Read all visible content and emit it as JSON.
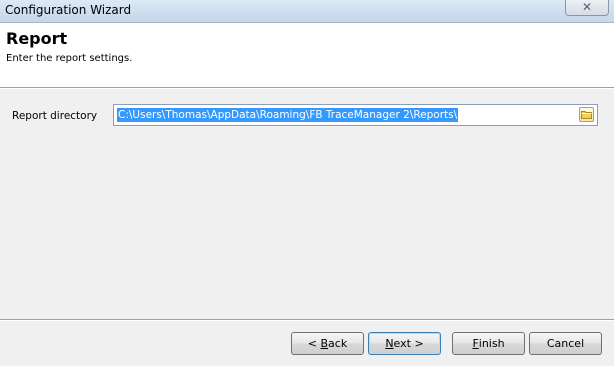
{
  "window": {
    "title": "Configuration Wizard"
  },
  "header": {
    "title": "Report",
    "subtitle": "Enter the report settings."
  },
  "form": {
    "directory_label": "Report directory",
    "directory_value": "C:\\Users\\Thomas\\AppData\\Roaming\\FB TraceManager 2\\Reports\\"
  },
  "buttons": {
    "back": {
      "prefix": "< ",
      "mnemonic": "B",
      "rest": "ack"
    },
    "next": {
      "mnemonic": "N",
      "rest": "ext >"
    },
    "finish": {
      "mnemonic": "F",
      "rest": "inish"
    },
    "cancel": "Cancel"
  },
  "icons": {
    "close": "close-icon",
    "browse": "folder-icon"
  }
}
